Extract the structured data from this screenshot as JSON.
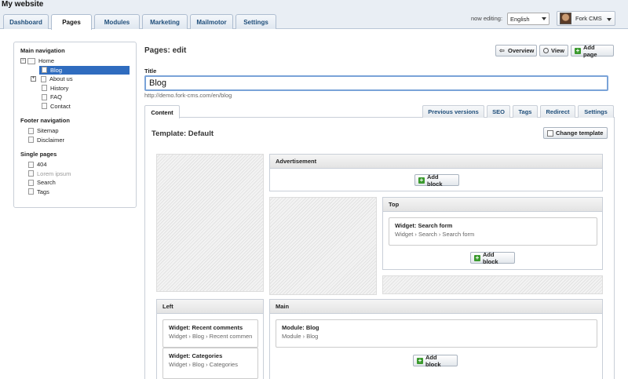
{
  "app": {
    "site_title": "My website"
  },
  "nav": {
    "tabs": [
      {
        "label": "Dashboard"
      },
      {
        "label": "Pages"
      },
      {
        "label": "Modules"
      },
      {
        "label": "Marketing"
      },
      {
        "label": "Mailmotor"
      },
      {
        "label": "Settings"
      }
    ],
    "active_tab": "Pages"
  },
  "header": {
    "now_editing_label": "now editing:",
    "language": "English",
    "user_name": "Fork CMS"
  },
  "sidebar": {
    "main_nav_heading": "Main navigation",
    "main_nav": [
      {
        "label": "Home"
      },
      {
        "label": "Blog"
      },
      {
        "label": "About us"
      },
      {
        "label": "History"
      },
      {
        "label": "FAQ"
      },
      {
        "label": "Contact"
      }
    ],
    "footer_nav_heading": "Footer navigation",
    "footer_nav": [
      {
        "label": "Sitemap"
      },
      {
        "label": "Disclaimer"
      }
    ],
    "single_pages_heading": "Single pages",
    "single_pages": [
      {
        "label": "404"
      },
      {
        "label": "Lorem ipsum"
      },
      {
        "label": "Search"
      },
      {
        "label": "Tags"
      }
    ]
  },
  "main": {
    "page_heading": "Pages: edit",
    "buttons": {
      "overview": "Overview",
      "view": "View",
      "add_page": "Add page"
    },
    "title_label": "Title",
    "title_value": "Blog",
    "url": "http://demo.fork-cms.com/en/blog",
    "tabs": [
      {
        "label": "Content"
      },
      {
        "label": "Previous versions"
      },
      {
        "label": "SEO"
      },
      {
        "label": "Tags"
      },
      {
        "label": "Redirect"
      },
      {
        "label": "Settings"
      }
    ],
    "template_title": "Template: Default",
    "change_template": "Change template",
    "add_block": "Add block",
    "blocks": {
      "advertisement": {
        "title": "Advertisement"
      },
      "top": {
        "title": "Top",
        "widget_title": "Widget: Search form",
        "widget_path": "Widget › Search › Search form"
      },
      "left": {
        "title": "Left",
        "widgets": [
          {
            "title": "Widget: Recent comments",
            "path": "Widget › Blog › Recent comments"
          },
          {
            "title": "Widget: Categories",
            "path": "Widget › Blog › Categories"
          }
        ]
      },
      "main": {
        "title": "Main",
        "widget_title": "Module: Blog",
        "widget_path": "Module › Blog"
      }
    }
  }
}
